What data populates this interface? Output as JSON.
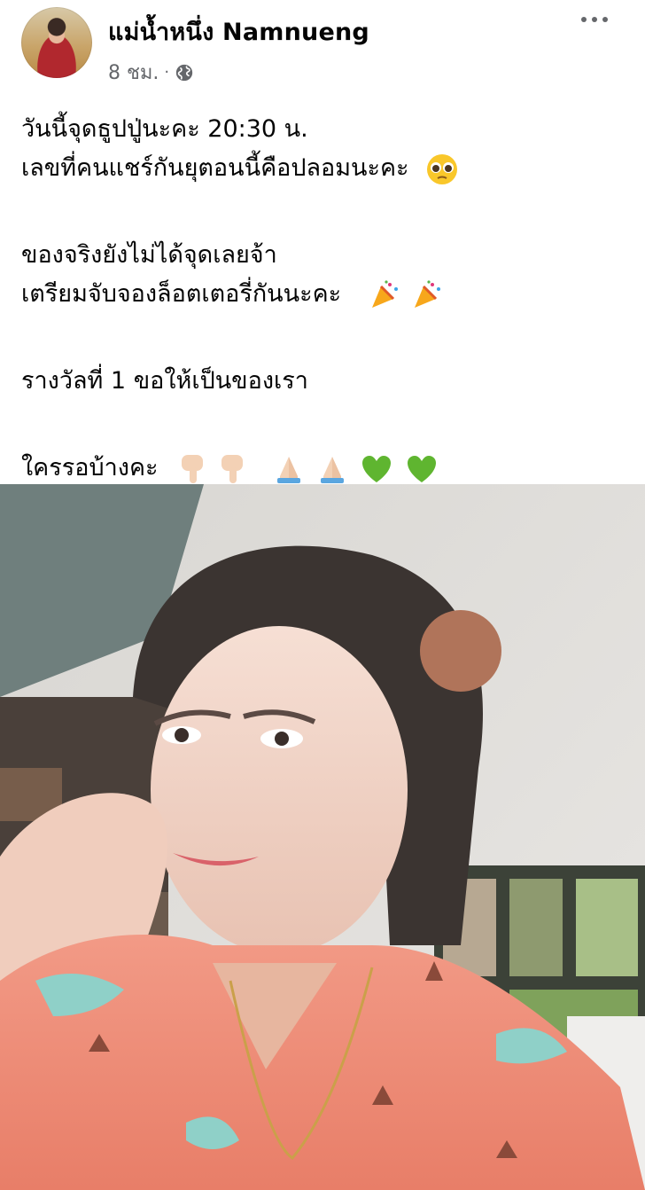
{
  "post": {
    "author_name": "แม่น้ำหนึ่ง Namnueng",
    "time": "8 ชม.",
    "separator": "·",
    "privacy_icon": "globe-icon",
    "more_icon": "more-options-icon",
    "lines": [
      "วันนี้จุดธูปปู่นะคะ  20:30 น.",
      "เลขที่คนแชร์กันยุตอนนี้คือปลอมนะคะ",
      "ของจริงยังไม่ได้จุดเลยจ้า",
      "เตรียมจับจองล็อตเตอรี่กันนะคะ",
      "รางวัลที่ 1 ขอให้เป็นของเรา",
      "ใครรอบ้างคะ"
    ],
    "emojis": {
      "line2": "pleading-face-emoji",
      "line4": [
        "party-popper-emoji",
        "party-popper-emoji"
      ],
      "line6": [
        "backhand-index-pointing-down-emoji",
        "backhand-index-pointing-down-emoji",
        "folded-hands-emoji",
        "folded-hands-emoji",
        "green-heart-emoji",
        "green-heart-emoji"
      ]
    },
    "photo": "selfie-photo"
  },
  "colors": {
    "text": "#050505",
    "meta": "#65676b",
    "shirt": "#f08e78",
    "heart": "#5fb530"
  }
}
